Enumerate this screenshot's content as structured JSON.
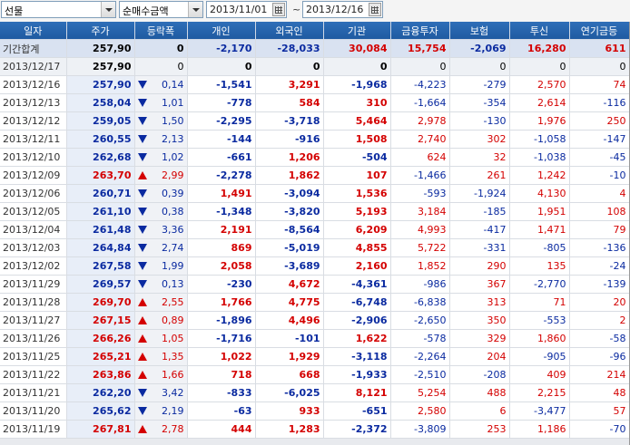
{
  "toolbar": {
    "market_select": "선물",
    "value_select": "순매수금액",
    "date_from": "2013/11/01",
    "date_to": "2013/12/16",
    "tilde": "~"
  },
  "columns": [
    "일자",
    "주가",
    "등락폭",
    "개인",
    "외국인",
    "기관",
    "금융투자",
    "보험",
    "투신",
    "연기금등"
  ],
  "colors": {
    "up": "#d40000",
    "down": "#0a2aa0",
    "header": "#1f5aa1"
  },
  "rows": [
    {
      "date": "기간합계",
      "price": "257,90",
      "dir": "",
      "chg": "0",
      "indiv": "-2,170",
      "foreign": "-28,033",
      "inst": "30,084",
      "fin": "15,754",
      "ins": "-2,069",
      "trust": "16,280",
      "pension": "611",
      "type": "total"
    },
    {
      "date": "2013/12/17",
      "price": "257,90",
      "dir": "",
      "chg": "0",
      "indiv": "0",
      "foreign": "0",
      "inst": "0",
      "fin": "0",
      "ins": "0",
      "trust": "0",
      "pension": "0",
      "type": "zero"
    },
    {
      "date": "2013/12/16",
      "price": "257,90",
      "dir": "dn",
      "chg": "0,14",
      "indiv": "-1,541",
      "foreign": "3,291",
      "inst": "-1,968",
      "fin": "-4,223",
      "ins": "-279",
      "trust": "2,570",
      "pension": "74"
    },
    {
      "date": "2013/12/13",
      "price": "258,04",
      "dir": "dn",
      "chg": "1,01",
      "indiv": "-778",
      "foreign": "584",
      "inst": "310",
      "fin": "-1,664",
      "ins": "-354",
      "trust": "2,614",
      "pension": "-116"
    },
    {
      "date": "2013/12/12",
      "price": "259,05",
      "dir": "dn",
      "chg": "1,50",
      "indiv": "-2,295",
      "foreign": "-3,718",
      "inst": "5,464",
      "fin": "2,978",
      "ins": "-130",
      "trust": "1,976",
      "pension": "250"
    },
    {
      "date": "2013/12/11",
      "price": "260,55",
      "dir": "dn",
      "chg": "2,13",
      "indiv": "-144",
      "foreign": "-916",
      "inst": "1,508",
      "fin": "2,740",
      "ins": "302",
      "trust": "-1,058",
      "pension": "-147"
    },
    {
      "date": "2013/12/10",
      "price": "262,68",
      "dir": "dn",
      "chg": "1,02",
      "indiv": "-661",
      "foreign": "1,206",
      "inst": "-504",
      "fin": "624",
      "ins": "32",
      "trust": "-1,038",
      "pension": "-45"
    },
    {
      "date": "2013/12/09",
      "price": "263,70",
      "dir": "up",
      "chg": "2,99",
      "indiv": "-2,278",
      "foreign": "1,862",
      "inst": "107",
      "fin": "-1,466",
      "ins": "261",
      "trust": "1,242",
      "pension": "-10"
    },
    {
      "date": "2013/12/06",
      "price": "260,71",
      "dir": "dn",
      "chg": "0,39",
      "indiv": "1,491",
      "foreign": "-3,094",
      "inst": "1,536",
      "fin": "-593",
      "ins": "-1,924",
      "trust": "4,130",
      "pension": "4"
    },
    {
      "date": "2013/12/05",
      "price": "261,10",
      "dir": "dn",
      "chg": "0,38",
      "indiv": "-1,348",
      "foreign": "-3,820",
      "inst": "5,193",
      "fin": "3,184",
      "ins": "-185",
      "trust": "1,951",
      "pension": "108"
    },
    {
      "date": "2013/12/04",
      "price": "261,48",
      "dir": "dn",
      "chg": "3,36",
      "indiv": "2,191",
      "foreign": "-8,564",
      "inst": "6,209",
      "fin": "4,993",
      "ins": "-417",
      "trust": "1,471",
      "pension": "79"
    },
    {
      "date": "2013/12/03",
      "price": "264,84",
      "dir": "dn",
      "chg": "2,74",
      "indiv": "869",
      "foreign": "-5,019",
      "inst": "4,855",
      "fin": "5,722",
      "ins": "-331",
      "trust": "-805",
      "pension": "-136"
    },
    {
      "date": "2013/12/02",
      "price": "267,58",
      "dir": "dn",
      "chg": "1,99",
      "indiv": "2,058",
      "foreign": "-3,689",
      "inst": "2,160",
      "fin": "1,852",
      "ins": "290",
      "trust": "135",
      "pension": "-24"
    },
    {
      "date": "2013/11/29",
      "price": "269,57",
      "dir": "dn",
      "chg": "0,13",
      "indiv": "-230",
      "foreign": "4,672",
      "inst": "-4,361",
      "fin": "-986",
      "ins": "367",
      "trust": "-2,770",
      "pension": "-139"
    },
    {
      "date": "2013/11/28",
      "price": "269,70",
      "dir": "up",
      "chg": "2,55",
      "indiv": "1,766",
      "foreign": "4,775",
      "inst": "-6,748",
      "fin": "-6,838",
      "ins": "313",
      "trust": "71",
      "pension": "20"
    },
    {
      "date": "2013/11/27",
      "price": "267,15",
      "dir": "up",
      "chg": "0,89",
      "indiv": "-1,896",
      "foreign": "4,496",
      "inst": "-2,906",
      "fin": "-2,650",
      "ins": "350",
      "trust": "-553",
      "pension": "2"
    },
    {
      "date": "2013/11/26",
      "price": "266,26",
      "dir": "up",
      "chg": "1,05",
      "indiv": "-1,716",
      "foreign": "-101",
      "inst": "1,622",
      "fin": "-578",
      "ins": "329",
      "trust": "1,860",
      "pension": "-58"
    },
    {
      "date": "2013/11/25",
      "price": "265,21",
      "dir": "up",
      "chg": "1,35",
      "indiv": "1,022",
      "foreign": "1,929",
      "inst": "-3,118",
      "fin": "-2,264",
      "ins": "204",
      "trust": "-905",
      "pension": "-96"
    },
    {
      "date": "2013/11/22",
      "price": "263,86",
      "dir": "up",
      "chg": "1,66",
      "indiv": "718",
      "foreign": "668",
      "inst": "-1,933",
      "fin": "-2,510",
      "ins": "-208",
      "trust": "409",
      "pension": "214"
    },
    {
      "date": "2013/11/21",
      "price": "262,20",
      "dir": "dn",
      "chg": "3,42",
      "indiv": "-833",
      "foreign": "-6,025",
      "inst": "8,121",
      "fin": "5,254",
      "ins": "488",
      "trust": "2,215",
      "pension": "48"
    },
    {
      "date": "2013/11/20",
      "price": "265,62",
      "dir": "dn",
      "chg": "2,19",
      "indiv": "-63",
      "foreign": "933",
      "inst": "-651",
      "fin": "2,580",
      "ins": "6",
      "trust": "-3,477",
      "pension": "57"
    },
    {
      "date": "2013/11/19",
      "price": "267,81",
      "dir": "up",
      "chg": "2,78",
      "indiv": "444",
      "foreign": "1,283",
      "inst": "-2,372",
      "fin": "-3,809",
      "ins": "253",
      "trust": "1,186",
      "pension": "-70"
    }
  ]
}
